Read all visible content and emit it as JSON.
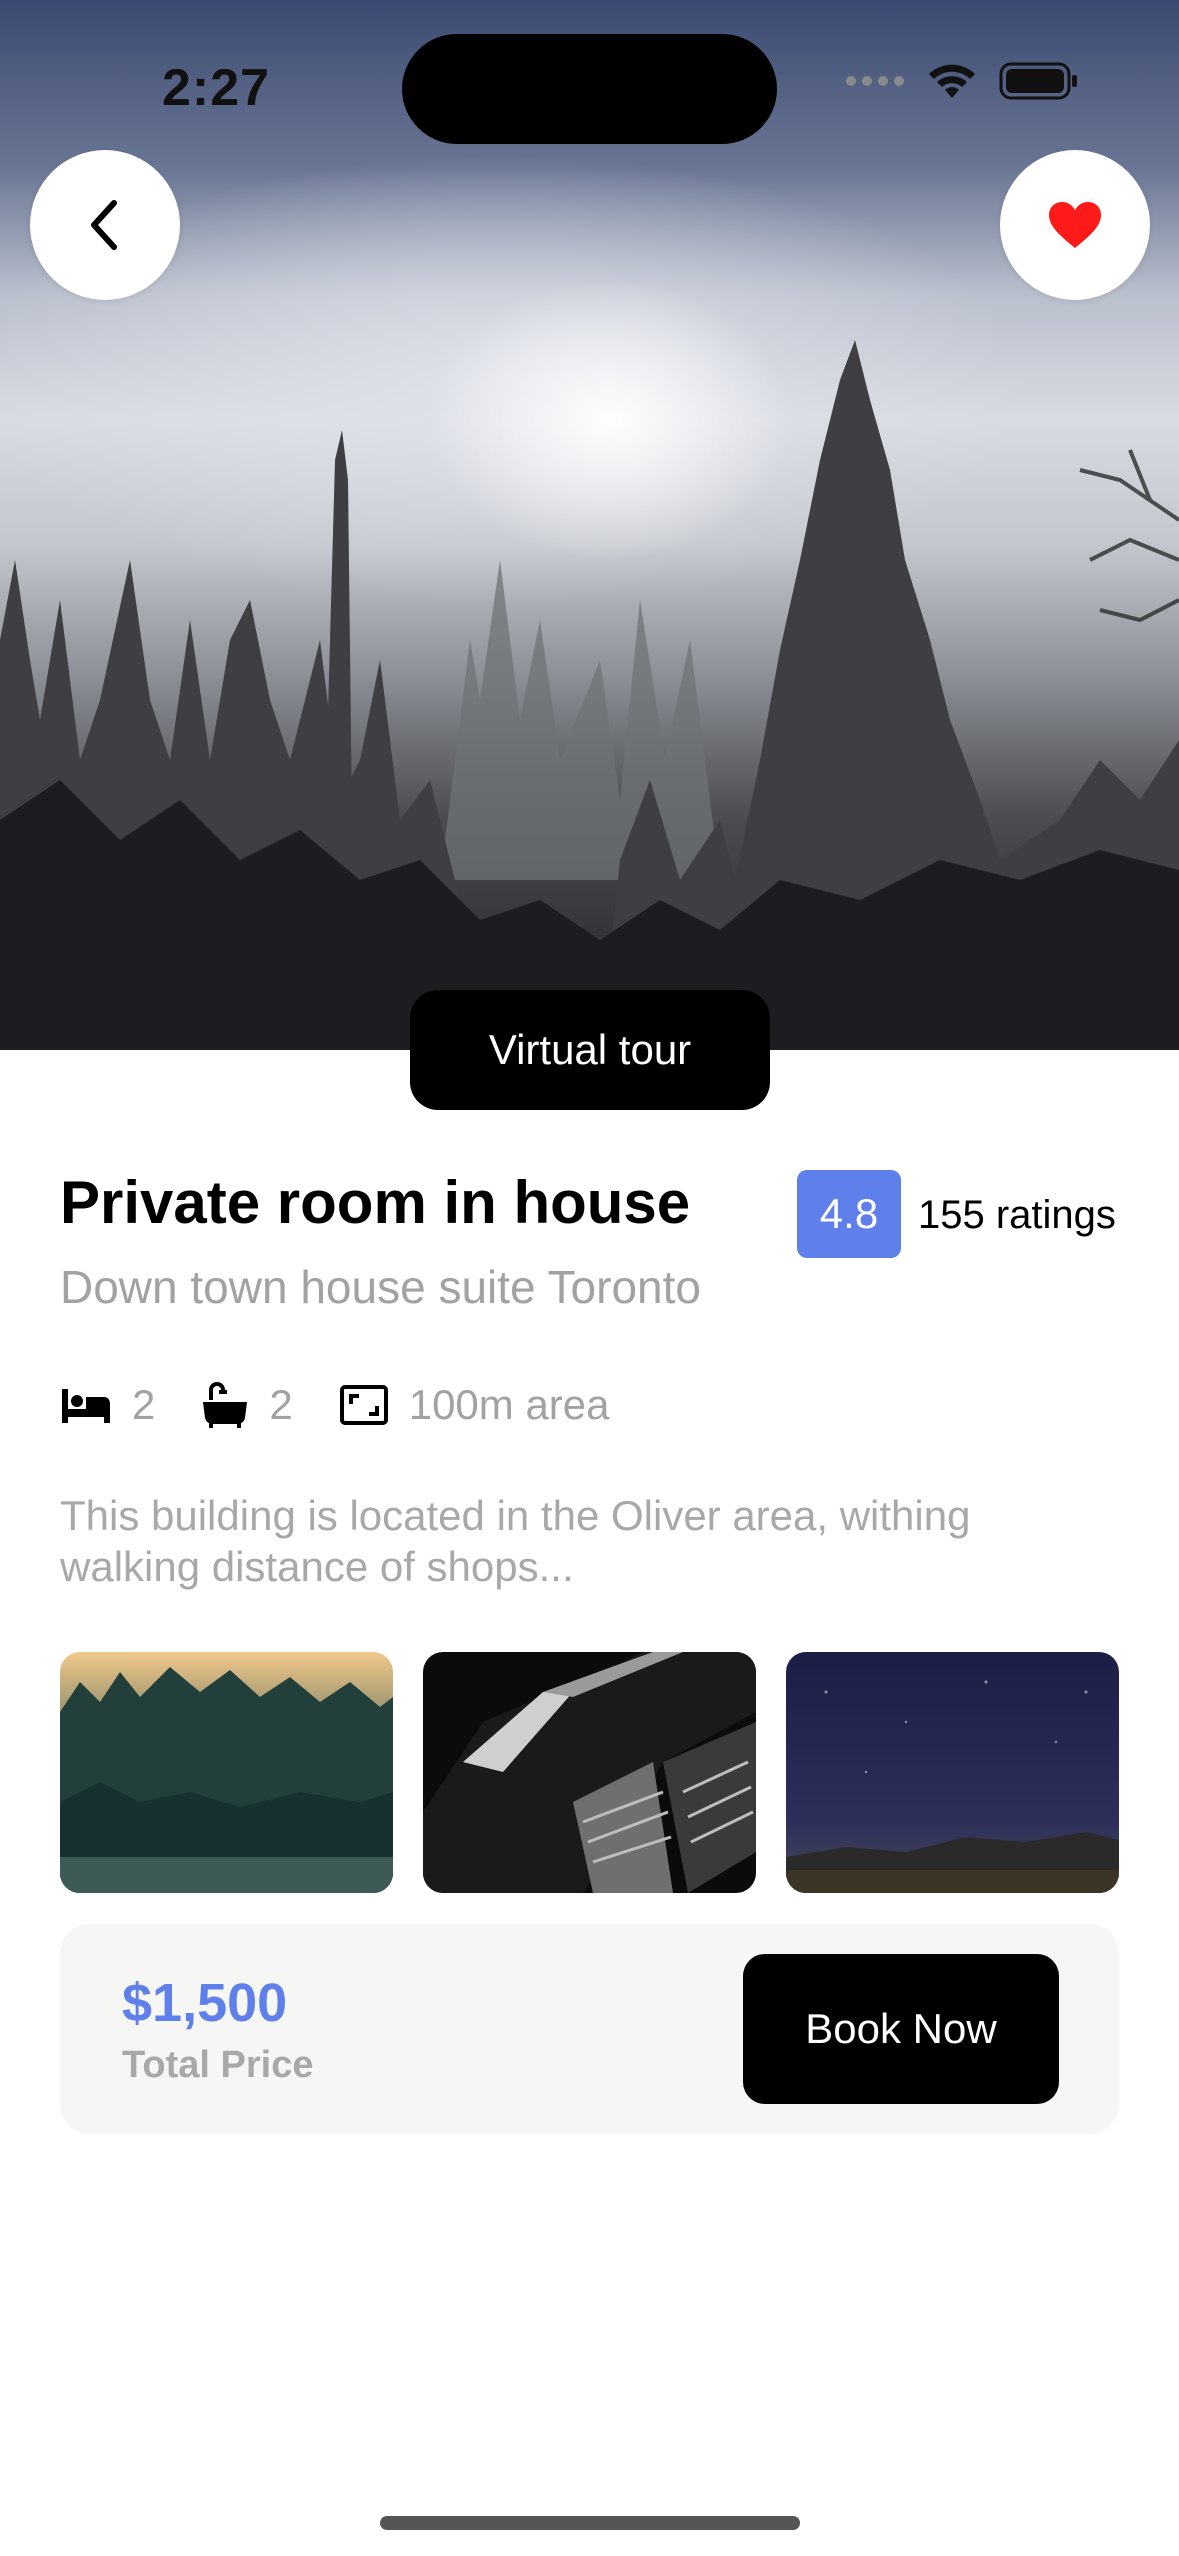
{
  "status_bar": {
    "time": "2:27",
    "icons": [
      "cellular-signal-icon",
      "wifi-icon",
      "battery-icon"
    ]
  },
  "hero": {
    "image": "misty-forest-photo",
    "back_icon": "chevron-left-icon",
    "favorite_icon": "heart-icon",
    "favorite_color": "#ff1a1a",
    "virtual_tour_label": "Virtual tour"
  },
  "listing": {
    "title": "Private room in house",
    "subtitle": "Down town house suite Toronto",
    "rating": "4.8",
    "rating_count": "155 ratings",
    "rating_color": "#5f80ea",
    "features": [
      {
        "icon": "bed-icon",
        "value": "2"
      },
      {
        "icon": "bathtub-icon",
        "value": "2"
      },
      {
        "icon": "area-frame-icon",
        "value": "100m area"
      }
    ],
    "description": "This building is located in the Oliver area, withing walking distance of shops..."
  },
  "gallery": [
    {
      "name": "forest-photo"
    },
    {
      "name": "building-photo"
    },
    {
      "name": "night-sky-photo"
    }
  ],
  "booking": {
    "price": "$1,500",
    "price_label": "Total Price",
    "book_label": "Book Now",
    "accent": "#5f80ea"
  }
}
